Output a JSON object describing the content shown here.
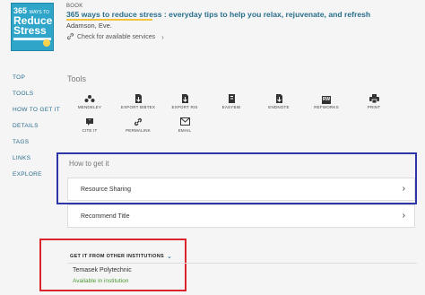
{
  "record": {
    "type": "BOOK",
    "title": "365 ways to reduce stress : everyday tips to help you relax, rejuvenate, and refresh",
    "author": "Adamson, Eve.",
    "check_services": "Check for available services",
    "cover": {
      "line1": "365",
      "line1_small": "WAYS TO",
      "line2": "Reduce",
      "line3": "Stress"
    }
  },
  "nav": {
    "items": [
      "TOP",
      "TOOLS",
      "HOW TO GET IT",
      "DETAILS",
      "TAGS",
      "LINKS",
      "EXPLORE"
    ]
  },
  "tools": {
    "heading": "Tools",
    "items": [
      {
        "label": "MENDELEY",
        "icon": "mendeley-icon"
      },
      {
        "label": "EXPORT BIBTEX",
        "icon": "export-bibtex-icon"
      },
      {
        "label": "EXPORT RIS",
        "icon": "export-ris-icon"
      },
      {
        "label": "EASYBIB",
        "icon": "easybib-icon"
      },
      {
        "label": "ENDNOTE",
        "icon": "endnote-icon"
      },
      {
        "label": "REFWORKS",
        "icon": "refworks-icon",
        "icon_text": "RW"
      },
      {
        "label": "PRINT",
        "icon": "print-icon"
      },
      {
        "label": "CITE IT",
        "icon": "cite-icon"
      },
      {
        "label": "PERMALINK",
        "icon": "permalink-icon"
      },
      {
        "label": "EMAIL",
        "icon": "email-icon"
      }
    ]
  },
  "how_to_get_it": {
    "heading": "How to get it",
    "options": [
      {
        "label": "Resource Sharing"
      },
      {
        "label": "Recommend Title"
      }
    ]
  },
  "other_institutions": {
    "heading": "GET IT FROM OTHER INSTITUTIONS",
    "institution": "Temasek Polytechnic",
    "status": "Available in institution",
    "status_color": "#4a9a32"
  },
  "colors": {
    "link": "#2b6e8e",
    "highlight_blue": "#2d35a8",
    "highlight_red": "#d9252b",
    "title_underline": "#f3c33c"
  }
}
